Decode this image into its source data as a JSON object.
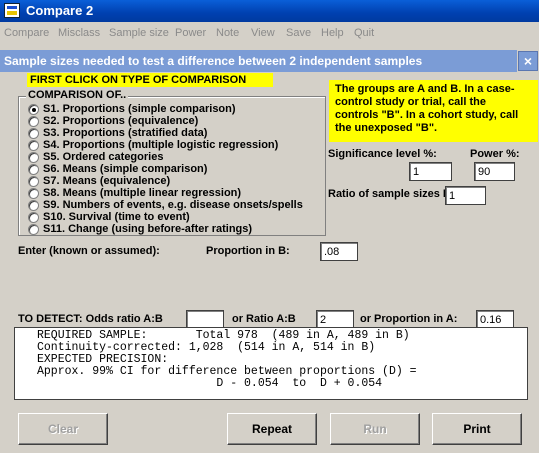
{
  "window": {
    "title": "Compare 2"
  },
  "menu": [
    "Compare",
    "Misclass",
    "Sample size",
    "Power",
    "Note",
    "View",
    "Save",
    "Help",
    "Quit"
  ],
  "dialog": {
    "title": "Sample sizes needed to test a difference between 2 independent samples",
    "close": "×",
    "first_click": "FIRST CLICK ON TYPE OF COMPARISON",
    "note": "The groups are A and B.  In a case-control study or trial, call the controls \"B\".  In a cohort study, call the unexposed \"B\".",
    "comparison_legend": "COMPARISON OF..",
    "options": [
      "S1. Proportions (simple comparison)",
      "S2. Proportions (equivalence)",
      "S3. Proportions (stratified data)",
      "S4. Proportions (multiple logistic regression)",
      "S5. Ordered categories",
      "S6. Means (simple comparison)",
      "S7. Means (equivalence)",
      "S8. Means (multiple linear regression)",
      "S9. Numbers of events, e.g. disease onsets/spells",
      "S10. Survival (time to event)",
      "S11. Change (using before-after ratings)"
    ],
    "selected_option": 0,
    "significance_label": "Significance level %:",
    "significance_value": "1",
    "power_label": "Power %:",
    "power_value": "90",
    "ratio_label": "Ratio of sample sizes B:A",
    "ratio_value": "1",
    "enter_label": "Enter (known or assumed):",
    "prop_b_label": "Proportion in B:",
    "prop_b_value": ".08",
    "detect_label": "TO  DETECT: Odds ratio A:B",
    "odds_ratio_value": "",
    "or_ratio_label": "or  Ratio A:B",
    "ratio_ab_value": "2",
    "or_prop_a_label": "or  Proportion in A:",
    "prop_a_value": "0.16",
    "results": [
      "REQUIRED SAMPLE:       Total 978  (489 in A, 489 in B)",
      "Continuity-corrected: 1,028  (514 in A, 514 in B)",
      "EXPECTED PRECISION:",
      "Approx. 99% CI for difference between proportions (D) =",
      "                          D - 0.054  to  D + 0.054"
    ],
    "buttons": {
      "clear": "Clear",
      "repeat": "Repeat",
      "run": "Run",
      "print": "Print"
    }
  }
}
